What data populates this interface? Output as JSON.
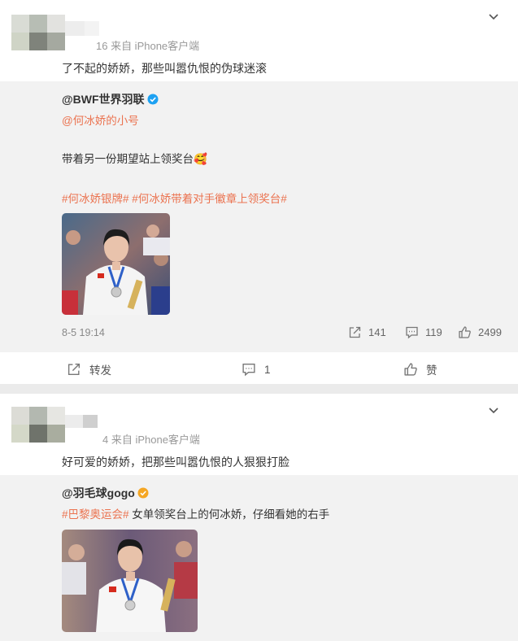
{
  "posts": [
    {
      "source_text": "16 来自 iPhone客户端",
      "text": "了不起的娇娇，那些叫嚣仇恨的伪球迷滚",
      "repost": {
        "author": "@BWF世界羽联",
        "mention": "@何冰娇的小号",
        "body": "带着另一份期望站上领奖台🥰",
        "hashtags": "#何冰娇银牌# #何冰娇带着对手徽章上领奖台#",
        "date": "8-5 19:14",
        "shares": "141",
        "comments": "119",
        "likes": "2499"
      },
      "actions": {
        "share": "转发",
        "comment": "1",
        "like": "赞"
      }
    },
    {
      "source_text": "4 来自 iPhone客户端",
      "text": "好可爱的娇娇，把那些叫嚣仇恨的人狠狠打脸",
      "repost": {
        "author": "@羽毛球gogo",
        "hashtag": "#巴黎奥运会#",
        "body": " 女单领奖台上的何冰娇，仔细看她的右手"
      }
    }
  ],
  "icons": {
    "chevron": "chevron-down-icon",
    "verified_blue": "verified-blue-icon",
    "verified_orange": "verified-orange-icon",
    "share": "share-icon",
    "comment": "comment-icon",
    "like": "thumbs-up-icon"
  },
  "colors": {
    "link": "#eb7350",
    "verified_blue": "#1da1f2",
    "verified_orange": "#f5a623"
  }
}
